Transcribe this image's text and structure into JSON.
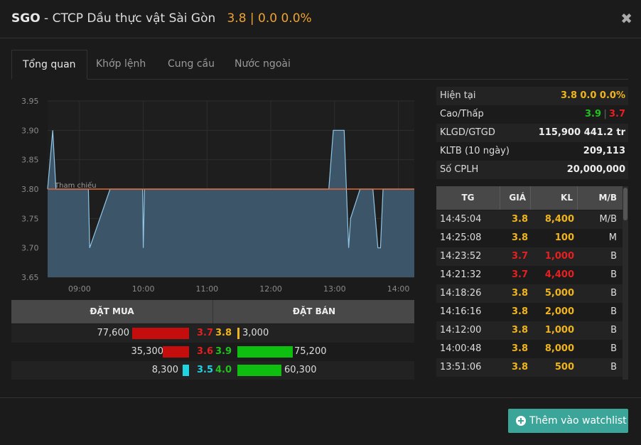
{
  "header": {
    "symbol": "SGO",
    "company": " - CTCP Dầu thực vật Sài Gòn",
    "price_text": "3.8 | 0.0 0.0%",
    "close_icon": "close-icon"
  },
  "tabs": [
    {
      "label": "Tổng quan",
      "active": true
    },
    {
      "label": "Khớp lệnh",
      "active": false
    },
    {
      "label": "Cung cầu",
      "active": false
    },
    {
      "label": "Nước ngoài",
      "active": false
    }
  ],
  "colors": {
    "yellow": "#f0b41e",
    "red": "#e62020",
    "green": "#21c21f",
    "cyan": "#1fd3e0",
    "area": "#3c5568",
    "line": "#8fc6e6",
    "ref_line": "#e06a3a",
    "button": "#3ba59a"
  },
  "chart_data": {
    "type": "area",
    "ylim": [
      3.65,
      3.95
    ],
    "yticks": [
      "3.95",
      "3.90",
      "3.85",
      "3.80",
      "3.75",
      "3.70",
      "3.65"
    ],
    "xticks": [
      "09:00",
      "10:00",
      "11:00",
      "12:00",
      "13:00",
      "14:00"
    ],
    "xlim_hours": [
      8.5,
      14.25
    ],
    "reference": 3.8,
    "reference_label": "Tham chiếu",
    "x": [
      8.5,
      8.58,
      8.63,
      8.68,
      9.14,
      9.16,
      9.48,
      9.5,
      9.99,
      10.0,
      10.02,
      11.0,
      12.0,
      12.5,
      12.91,
      12.98,
      13.15,
      13.22,
      13.25,
      13.4,
      13.6,
      13.68,
      13.72,
      13.76,
      14.25
    ],
    "y": [
      3.8,
      3.9,
      3.8,
      3.8,
      3.8,
      3.7,
      3.8,
      3.8,
      3.8,
      3.7,
      3.8,
      3.8,
      3.8,
      3.8,
      3.8,
      3.9,
      3.9,
      3.7,
      3.75,
      3.8,
      3.8,
      3.7,
      3.7,
      3.8,
      3.8
    ]
  },
  "orderbook": {
    "buy_header": "ĐẶT MUA",
    "sell_header": "ĐẶT BÁN",
    "rows": [
      {
        "buy_vol": "77,600",
        "buy_px": "3.7",
        "buy_color": "red",
        "sell_px": "3.8",
        "sell_color": "yellow",
        "sell_vol": "3,000",
        "buy_frac": 1.0,
        "sell_frac": 0.04
      },
      {
        "buy_vol": "35,300",
        "buy_px": "3.6",
        "buy_color": "red",
        "sell_px": "3.9",
        "sell_color": "green",
        "sell_vol": "75,200",
        "buy_frac": 0.46,
        "sell_frac": 0.97
      },
      {
        "buy_vol": "8,300",
        "buy_px": "3.5",
        "buy_color": "cyan",
        "sell_px": "4.0",
        "sell_color": "green",
        "sell_vol": "60,300",
        "buy_frac": 0.11,
        "sell_frac": 0.78
      }
    ]
  },
  "info": {
    "current_label": "Hiện tại",
    "current_price": "3.8",
    "current_change": "0.0 0.0%",
    "highlow_label": "Cao/Thấp",
    "high": "3.9",
    "low": "3.7",
    "klgd_label": "KLGD/GTGD",
    "klgd": "115,900",
    "gtgd": "441.2 tr",
    "kltb_label": "KLTB (10 ngày)",
    "kltb": "209,113",
    "cplh_label": "Số CPLH",
    "cplh": "20,000,000"
  },
  "trades": {
    "headers": [
      "TG",
      "GIÁ",
      "KL",
      "M/B"
    ],
    "rows": [
      {
        "time": "14:45:04",
        "price": "3.8",
        "vol": "8,400",
        "side": "M/B",
        "color": "yellow"
      },
      {
        "time": "14:25:08",
        "price": "3.8",
        "vol": "100",
        "side": "M",
        "color": "yellow"
      },
      {
        "time": "14:23:52",
        "price": "3.7",
        "vol": "1,000",
        "side": "B",
        "color": "red"
      },
      {
        "time": "14:21:32",
        "price": "3.7",
        "vol": "4,400",
        "side": "B",
        "color": "red"
      },
      {
        "time": "14:18:26",
        "price": "3.8",
        "vol": "5,000",
        "side": "B",
        "color": "yellow"
      },
      {
        "time": "14:16:16",
        "price": "3.8",
        "vol": "2,000",
        "side": "B",
        "color": "yellow"
      },
      {
        "time": "14:12:00",
        "price": "3.8",
        "vol": "1,000",
        "side": "B",
        "color": "yellow"
      },
      {
        "time": "14:00:48",
        "price": "3.8",
        "vol": "8,000",
        "side": "B",
        "color": "yellow"
      },
      {
        "time": "13:51:06",
        "price": "3.8",
        "vol": "500",
        "side": "B",
        "color": "yellow"
      }
    ]
  },
  "footer": {
    "watchlist_label": "Thêm vào watchlist",
    "watchlist_icon": "plus-circle-icon"
  }
}
